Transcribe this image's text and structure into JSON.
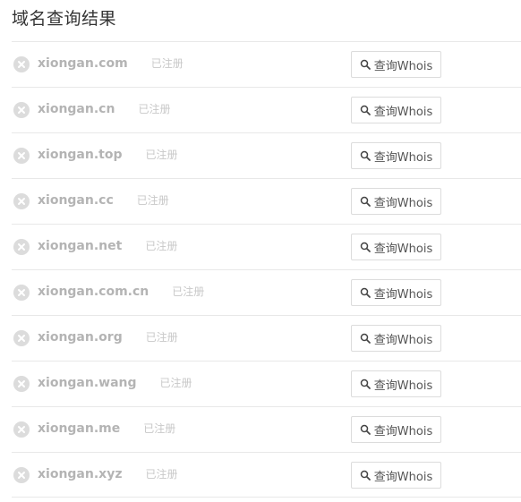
{
  "page": {
    "title": "域名查询结果"
  },
  "results": [
    {
      "domain": "xiongan.com",
      "status": "已注册",
      "button": "查询Whois"
    },
    {
      "domain": "xiongan.cn",
      "status": "已注册",
      "button": "查询Whois"
    },
    {
      "domain": "xiongan.top",
      "status": "已注册",
      "button": "查询Whois"
    },
    {
      "domain": "xiongan.cc",
      "status": "已注册",
      "button": "查询Whois"
    },
    {
      "domain": "xiongan.net",
      "status": "已注册",
      "button": "查询Whois"
    },
    {
      "domain": "xiongan.com.cn",
      "status": "已注册",
      "button": "查询Whois"
    },
    {
      "domain": "xiongan.org",
      "status": "已注册",
      "button": "查询Whois"
    },
    {
      "domain": "xiongan.wang",
      "status": "已注册",
      "button": "查询Whois"
    },
    {
      "domain": "xiongan.me",
      "status": "已注册",
      "button": "查询Whois"
    },
    {
      "domain": "xiongan.xyz",
      "status": "已注册",
      "button": "查询Whois"
    }
  ],
  "icons": {
    "status_icon": "close-circle-icon",
    "button_icon": "search-icon"
  },
  "colors": {
    "domain_text": "#b4b4b4",
    "status_icon": "#dcdcdc",
    "border": "#e8e8e8"
  }
}
